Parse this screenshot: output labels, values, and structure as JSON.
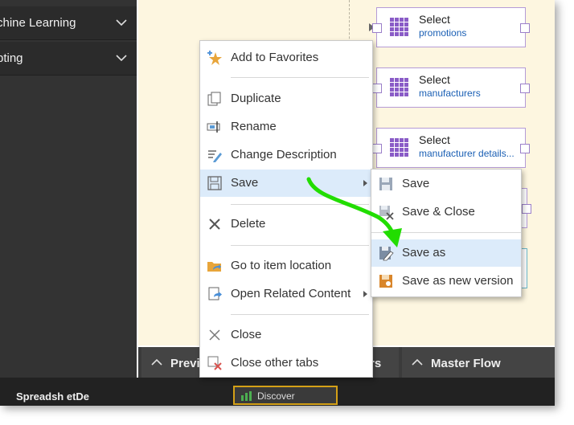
{
  "sidebar": {
    "items": [
      {
        "label": "chine Learning"
      },
      {
        "label": "pting"
      }
    ]
  },
  "canvas": {
    "nodes": [
      {
        "title": "Select",
        "subtitle": "promotions"
      },
      {
        "title": "Select",
        "subtitle": "manufacturers"
      },
      {
        "title": "Select",
        "subtitle": "manufacturer details..."
      }
    ]
  },
  "bottom_tabs": [
    {
      "label": "Previe"
    },
    {
      "label": "rs"
    },
    {
      "label": "Master Flow"
    }
  ],
  "statusbar": {
    "doc1": "Spreadsh  etDe",
    "doc2": "Discover"
  },
  "context_menu": {
    "items": [
      {
        "label": "Add to Favorites",
        "icon": "star-plus-icon"
      },
      {
        "label": "Duplicate",
        "icon": "duplicate-icon"
      },
      {
        "label": "Rename",
        "icon": "rename-icon"
      },
      {
        "label": "Change Description",
        "icon": "edit-description-icon"
      },
      {
        "label": "Save",
        "icon": "save-icon",
        "has_submenu": true
      },
      {
        "label": "Delete",
        "icon": "delete-icon"
      },
      {
        "label": "Go to item location",
        "icon": "folder-location-icon"
      },
      {
        "label": "Open Related Content",
        "icon": "related-content-icon",
        "has_submenu": true
      },
      {
        "label": "Close",
        "icon": "close-icon"
      },
      {
        "label": "Close other tabs",
        "icon": "close-tabs-icon"
      }
    ]
  },
  "save_submenu": {
    "items": [
      {
        "label": "Save",
        "icon": "save-icon"
      },
      {
        "label": "Save & Close",
        "icon": "save-close-icon"
      },
      {
        "label": "Save as",
        "icon": "save-as-icon"
      },
      {
        "label": "Save as new version",
        "icon": "save-new-version-icon"
      }
    ]
  },
  "colors": {
    "highlight": "#dcebfa",
    "annotation_arrow": "#22dd00",
    "node_border": "#b59bd6",
    "canvas_bg": "#fdf6e0"
  }
}
